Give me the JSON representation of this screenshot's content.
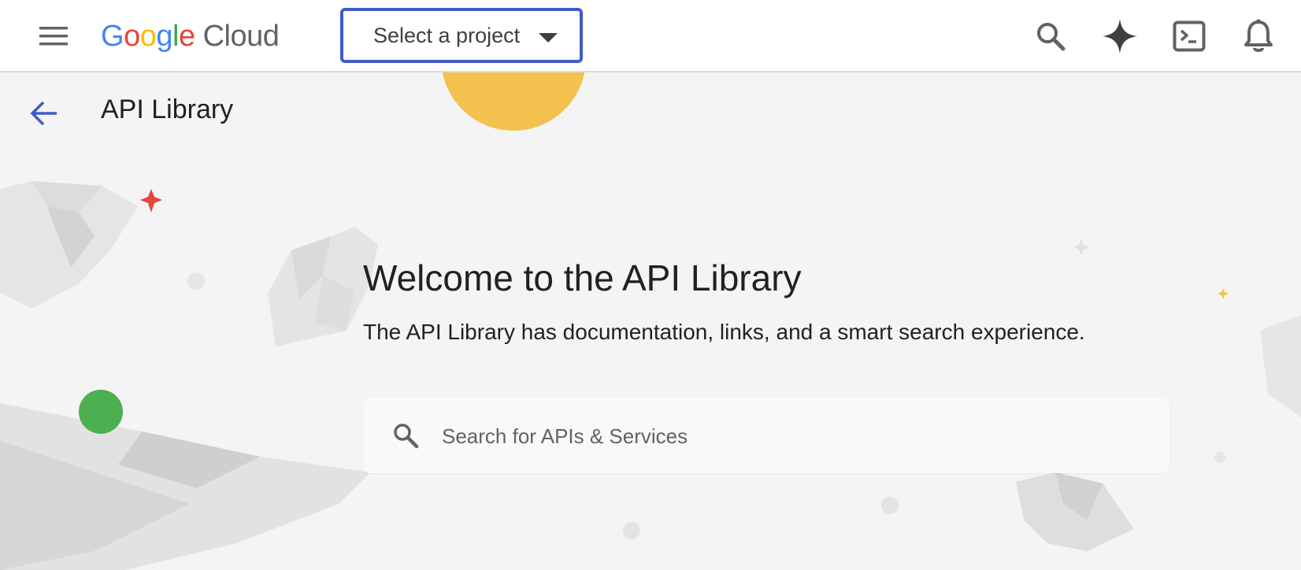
{
  "topbar": {
    "logo": {
      "google_letters": [
        "G",
        "o",
        "o",
        "g",
        "l",
        "e"
      ],
      "product": "Cloud"
    },
    "project_picker": {
      "label": "Select a project"
    },
    "icons": [
      "menu-icon",
      "search-icon",
      "gemini-sparkle-icon",
      "cloud-shell-terminal-icon",
      "notifications-bell-icon"
    ]
  },
  "page": {
    "title": "API Library"
  },
  "hero": {
    "heading": "Welcome to the API Library",
    "subtitle": "The API Library has documentation, links, and a smart search experience."
  },
  "search": {
    "placeholder": "Search for APIs & Services",
    "value": ""
  },
  "colors": {
    "accent_blue": "#3f5cc8",
    "background": "#f4f4f4",
    "decor_yellow": "#f2c14e",
    "decor_green": "#4caf50",
    "decor_red": "#e4473c"
  }
}
